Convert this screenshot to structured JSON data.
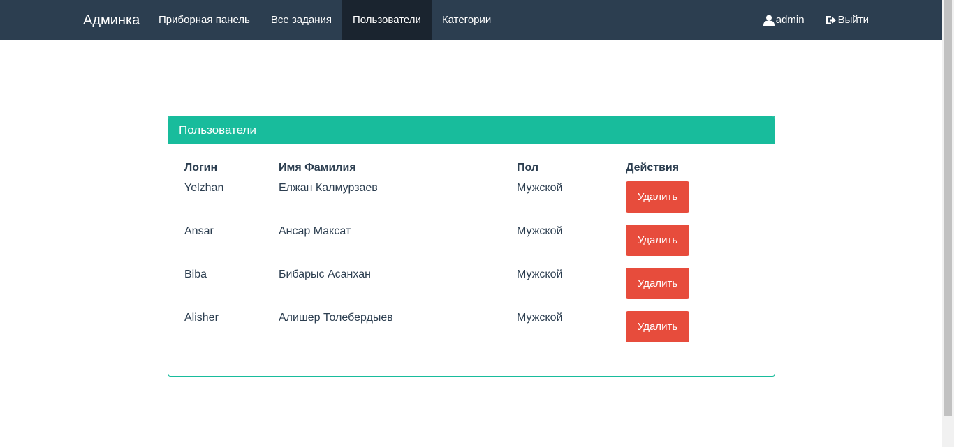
{
  "navbar": {
    "brand": "Админка",
    "items": [
      {
        "label": "Приборная панель"
      },
      {
        "label": "Все задания"
      },
      {
        "label": "Пользователи"
      },
      {
        "label": "Категории"
      }
    ],
    "user_label": "admin",
    "user_icon": "user-icon",
    "logout_label": "Выйти",
    "logout_icon": "sign-out-icon",
    "bg_color": "#2c3e50",
    "active_bg_color": "#1a242f"
  },
  "panel": {
    "title": "Пользователи",
    "accent_color": "#18bc9c",
    "columns": {
      "login": "Логин",
      "name": "Имя Фамилия",
      "gender": "Пол",
      "actions": "Действия"
    },
    "rows": [
      {
        "login": "Yelzhan",
        "name": "Елжан Калмурзаев",
        "gender": "Мужской",
        "action": "Удалить"
      },
      {
        "login": "Ansar",
        "name": "Ансар Максат",
        "gender": "Мужской",
        "action": "Удалить"
      },
      {
        "login": "Biba",
        "name": "Бибарыс Асанхан",
        "gender": "Мужской",
        "action": "Удалить"
      },
      {
        "login": "Alisher",
        "name": "Алишер Толебердыев",
        "gender": "Мужской",
        "action": "Удалить"
      }
    ],
    "delete_color": "#e74c3c"
  }
}
